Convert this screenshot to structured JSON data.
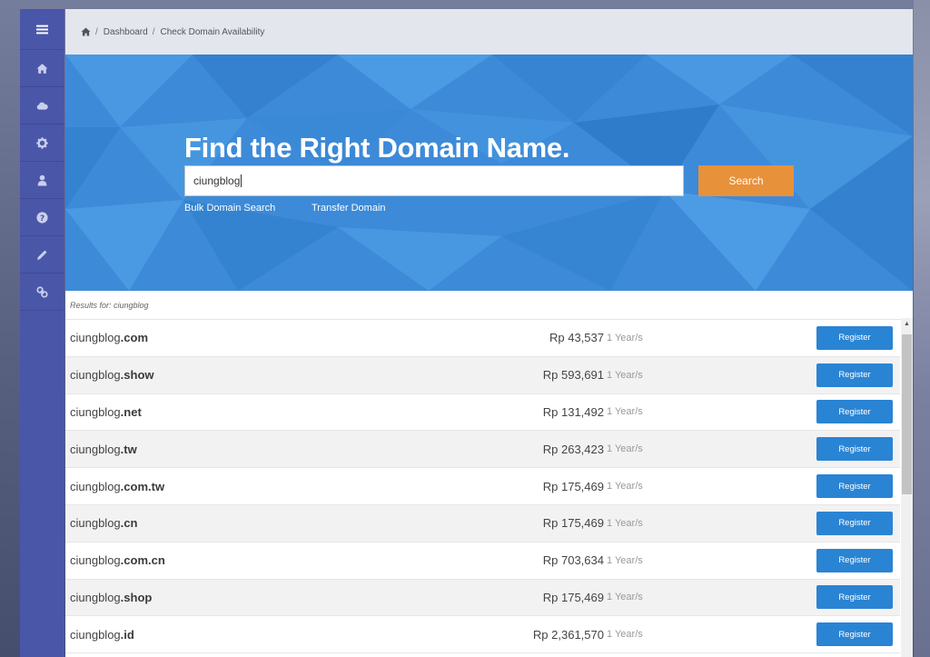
{
  "breadcrumb": {
    "home_icon": "home-icon",
    "items": [
      "Dashboard",
      "Check Domain Availability"
    ],
    "separator": "/"
  },
  "sidebar": {
    "items": [
      {
        "name": "menu",
        "icon": "hamburger-icon"
      },
      {
        "name": "home",
        "icon": "home-icon"
      },
      {
        "name": "cloud",
        "icon": "cloud-icon"
      },
      {
        "name": "settings",
        "icon": "gear-icon"
      },
      {
        "name": "account",
        "icon": "user-icon"
      },
      {
        "name": "help",
        "icon": "question-icon"
      },
      {
        "name": "edit",
        "icon": "pencil-icon"
      },
      {
        "name": "link",
        "icon": "link-icon"
      }
    ]
  },
  "hero": {
    "title": "Find the Right Domain Name.",
    "search_value": "ciungblog",
    "search_button": "Search",
    "links": [
      "Bulk Domain Search",
      "Transfer Domain"
    ]
  },
  "results": {
    "label_prefix": "Results for:",
    "query": "ciungblog",
    "register_label": "Register",
    "rows": [
      {
        "base": "ciungblog",
        "tld": ".com",
        "price": "Rp 43,537",
        "period": "1 Year/s"
      },
      {
        "base": "ciungblog",
        "tld": ".show",
        "price": "Rp 593,691",
        "period": "1 Year/s"
      },
      {
        "base": "ciungblog",
        "tld": ".net",
        "price": "Rp 131,492",
        "period": "1 Year/s"
      },
      {
        "base": "ciungblog",
        "tld": ".tw",
        "price": "Rp 263,423",
        "period": "1 Year/s"
      },
      {
        "base": "ciungblog",
        "tld": ".com.tw",
        "price": "Rp 175,469",
        "period": "1 Year/s"
      },
      {
        "base": "ciungblog",
        "tld": ".cn",
        "price": "Rp 175,469",
        "period": "1 Year/s"
      },
      {
        "base": "ciungblog",
        "tld": ".com.cn",
        "price": "Rp 703,634",
        "period": "1 Year/s"
      },
      {
        "base": "ciungblog",
        "tld": ".shop",
        "price": "Rp 175,469",
        "period": "1 Year/s"
      },
      {
        "base": "ciungblog",
        "tld": ".id",
        "price": "Rp 2,361,570",
        "period": "1 Year/s"
      }
    ]
  },
  "colors": {
    "sidebar": "#4a56a8",
    "hero": "#3f8fdc",
    "search_button": "#e8913b",
    "register_button": "#2a84d4"
  }
}
